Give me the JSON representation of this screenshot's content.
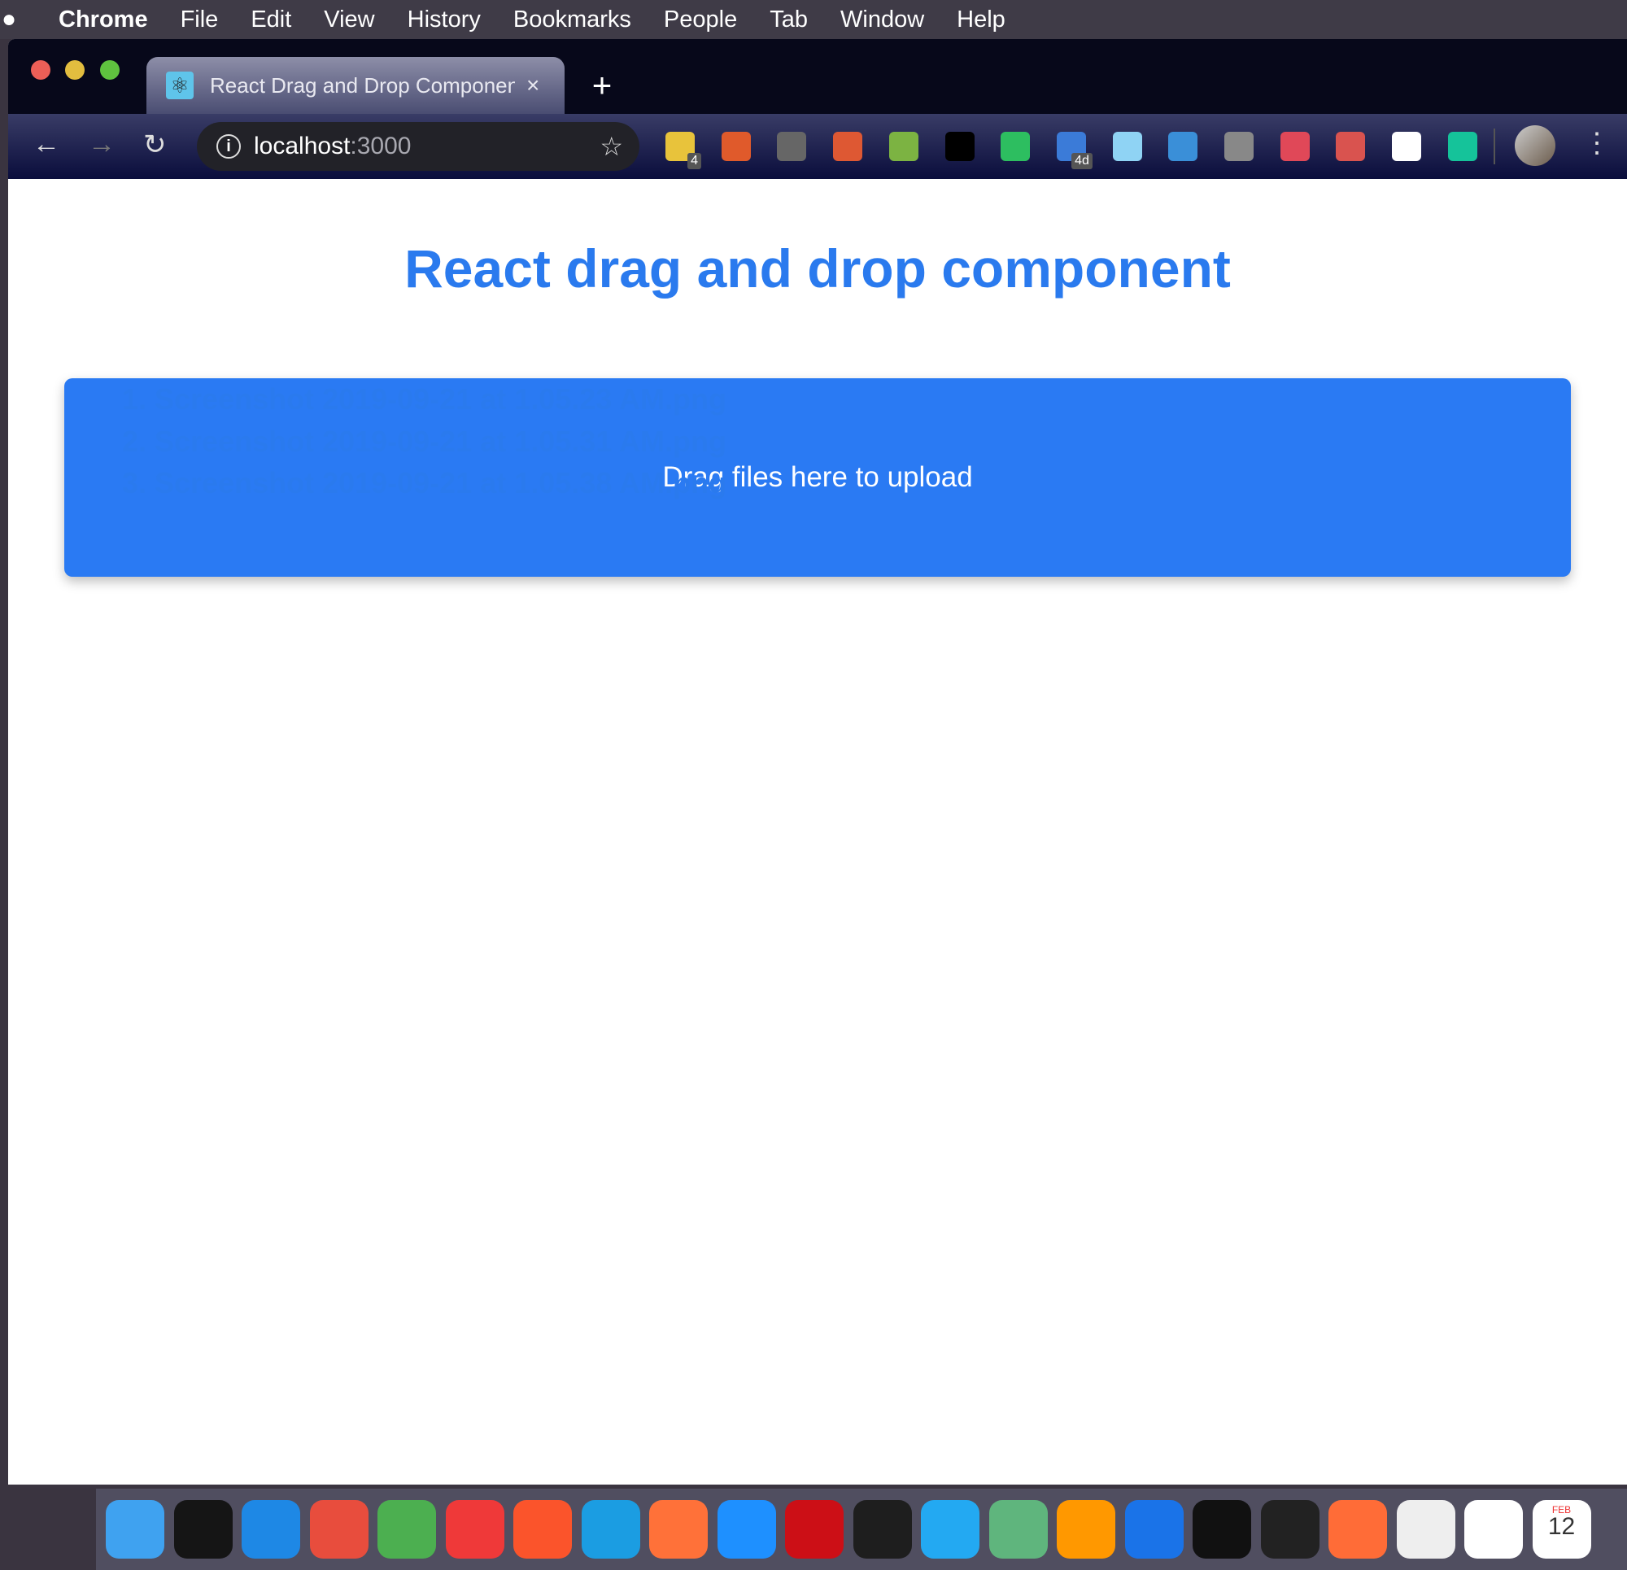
{
  "menubar": {
    "apple": "",
    "app": "Chrome",
    "items": [
      "File",
      "Edit",
      "View",
      "History",
      "Bookmarks",
      "People",
      "Tab",
      "Window",
      "Help"
    ]
  },
  "tab": {
    "title": "React Drag and Drop Component",
    "close": "×",
    "new_tab": "+"
  },
  "toolbar": {
    "back": "←",
    "forward": "→",
    "reload": "↻",
    "url_host": "localhost",
    "url_port": ":3000",
    "info": "i",
    "star": "☆",
    "menu": "⋮",
    "extensions": [
      {
        "name": "lastpass",
        "color": "#e8c33b",
        "badge": "4"
      },
      {
        "name": "codota",
        "color": "#e05a2b"
      },
      {
        "name": "sync",
        "color": "#666"
      },
      {
        "name": "duckduckgo",
        "color": "#de5833"
      },
      {
        "name": "print-friendly",
        "color": "#7cb342"
      },
      {
        "name": "back-arrow",
        "color": "#000"
      },
      {
        "name": "evernote",
        "color": "#2dbe60"
      },
      {
        "name": "tabs",
        "color": "#3b7bd8",
        "badge": "4d"
      },
      {
        "name": "bird",
        "color": "#8fd3f4"
      },
      {
        "name": "tv",
        "color": "#3a8fd8"
      },
      {
        "name": "circle",
        "color": "#888"
      },
      {
        "name": "r-ext",
        "color": "#e04858"
      },
      {
        "name": "react-devtools",
        "color": "#d9534f"
      },
      {
        "name": "cula",
        "color": "#ffffff"
      },
      {
        "name": "grammarly",
        "color": "#15c39a"
      }
    ]
  },
  "page": {
    "title": "React drag and drop component",
    "dropzone": "Drag files here to upload",
    "files": [
      {
        "n": "1.",
        "name": "Screenshot 2019-09-21 at 1.05.23 AM.png"
      },
      {
        "n": "2.",
        "name": "Screenshot 2019-09-21 at 1.05.31 AM.png"
      },
      {
        "n": "3.",
        "name": "Screenshot 2019-09-21 at 1.05.38 AM.png"
      }
    ]
  },
  "colors": {
    "accent": "#2a7af3",
    "title": "#2a7aee"
  },
  "dock": {
    "apps": [
      {
        "name": "finder",
        "color": "#3fa2f0"
      },
      {
        "name": "codesandbox",
        "color": "#151515"
      },
      {
        "name": "material-ui",
        "color": "#1e88e5"
      },
      {
        "name": "dc",
        "color": "#e84d3d"
      },
      {
        "name": "chrome",
        "color": "#4caf50"
      },
      {
        "name": "vivaldi",
        "color": "#ef3939"
      },
      {
        "name": "brave",
        "color": "#fb542b"
      },
      {
        "name": "edge-beta",
        "color": "#1b9de2"
      },
      {
        "name": "firefox",
        "color": "#ff7139"
      },
      {
        "name": "safari",
        "color": "#1e90ff"
      },
      {
        "name": "opera",
        "color": "#cc0f16"
      },
      {
        "name": "figma",
        "color": "#1e1e1e"
      },
      {
        "name": "vscode",
        "color": "#23a9f2"
      },
      {
        "name": "atom",
        "color": "#5fb57d"
      },
      {
        "name": "sublime",
        "color": "#ff9800"
      },
      {
        "name": "maps-pin",
        "color": "#1a73e8"
      },
      {
        "name": "iterm",
        "color": "#111"
      },
      {
        "name": "terminal",
        "color": "#222"
      },
      {
        "name": "postman",
        "color": "#ff6c37"
      },
      {
        "name": "slack",
        "color": "#eee"
      },
      {
        "name": "notion",
        "color": "#fff"
      },
      {
        "name": "calendar",
        "color": "#fff"
      }
    ],
    "calendar_month": "FEB",
    "calendar_day": "12"
  }
}
